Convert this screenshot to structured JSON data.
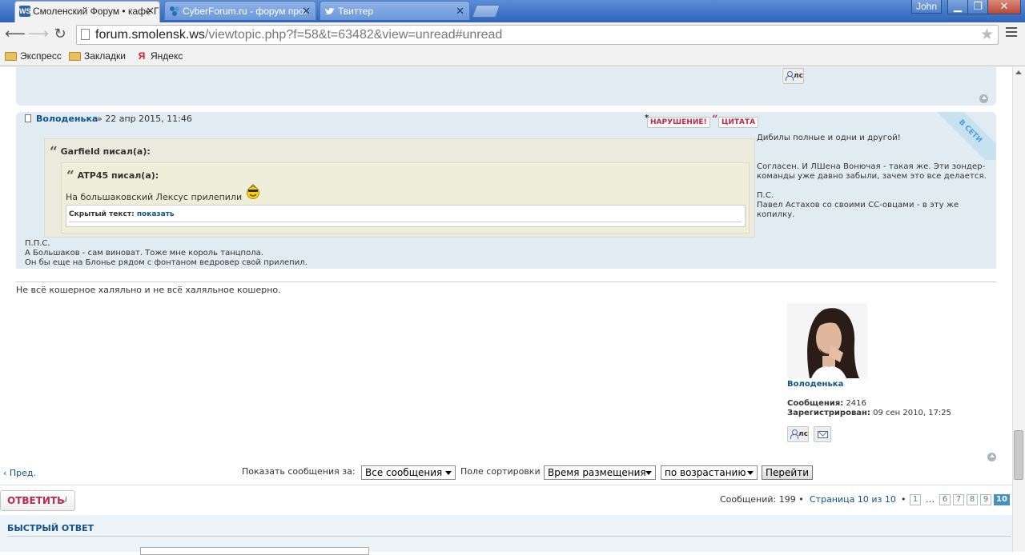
{
  "browser": {
    "tabs": [
      {
        "title": "Смоленский Форум • кафе Г",
        "favicon_text": "WS",
        "active": true
      },
      {
        "title": "CyberForum.ru - форум прог",
        "favicon_text": "",
        "active": false
      },
      {
        "title": "Твиттер",
        "favicon_text": "",
        "active": false
      }
    ],
    "user": "John",
    "window_controls": {
      "minimize": "▁",
      "maximize": "❐",
      "close": "✕"
    },
    "url_host": "forum.smolensk.ws",
    "url_path": "/viewtopic.php?f=58&t=63482&view=unread#unread",
    "bookmarks": [
      {
        "label": "Экспресс",
        "icon": "folder-icon"
      },
      {
        "label": "Закладки",
        "icon": "folder-icon"
      },
      {
        "label": "Яндекс",
        "icon": "yandex-icon",
        "glyph": "Я"
      }
    ]
  },
  "page": {
    "pm_label": "лс",
    "post": {
      "author": "Володенька",
      "date": "» 22 апр 2015, 11:46",
      "report_label": "НАРУШЕНИЕ!",
      "quote_label": "ЦИТАТА",
      "online_label": "В СЕТИ",
      "quote_outer_cite": "Garfield писал(а):",
      "quote_inner_cite": "ATP45 писал(а):",
      "quote_inner_text": "На большаковский Лексус прилепили",
      "hidden_label": "Скрытый текст",
      "hidden_sep": ":",
      "hidden_link": "показать",
      "right_text": [
        "Дибилы полные и одни и другой!",
        "Согласен. И ЛШена Вонючая - такая же. Эти зондер-команды уже давно забыли, зачем это все делается.",
        "П.С.",
        "Павел Астахов со своими СС-овцами - в эту же копилку."
      ],
      "after_text": [
        "П.П.С.",
        "А Большаков - сам виноват. Тоже мне король танцпола.",
        "Он бы еще на Блонье рядом с фонтаном ведровер свой прилепил."
      ],
      "signature": "Не всё кошерное халяльно и не всё халяльное кошерно.",
      "profile": {
        "name": "Володенька",
        "messages_label": "Сообщения:",
        "messages": "2416",
        "registered_label": "Зарегистрирован:",
        "registered": "09 сен 2010, 17:25"
      }
    },
    "nav": {
      "prev": "Пред.",
      "show_label": "Показать сообщения за:",
      "show_value": "Все сообщения",
      "sort_label": "Поле сортировки",
      "sort_value": "Время размещения",
      "order_value": "по возрастанию",
      "go": "Перейти"
    },
    "reply_button": "ОТВЕТИТЬ",
    "pagination": {
      "summary": "Сообщений: 199 •",
      "page_info": "Страница 10 из 10",
      "dot": "•",
      "pages": [
        "1",
        "…",
        "6",
        "7",
        "8",
        "9",
        "10"
      ]
    },
    "quick_reply": "БЫСТРЫЙ ОТВЕТ"
  },
  "colors": {
    "post_bg": "#e1ebf2",
    "link": "#105289",
    "accent_red": "#bc2a4d",
    "current_page": "#4692bf"
  }
}
